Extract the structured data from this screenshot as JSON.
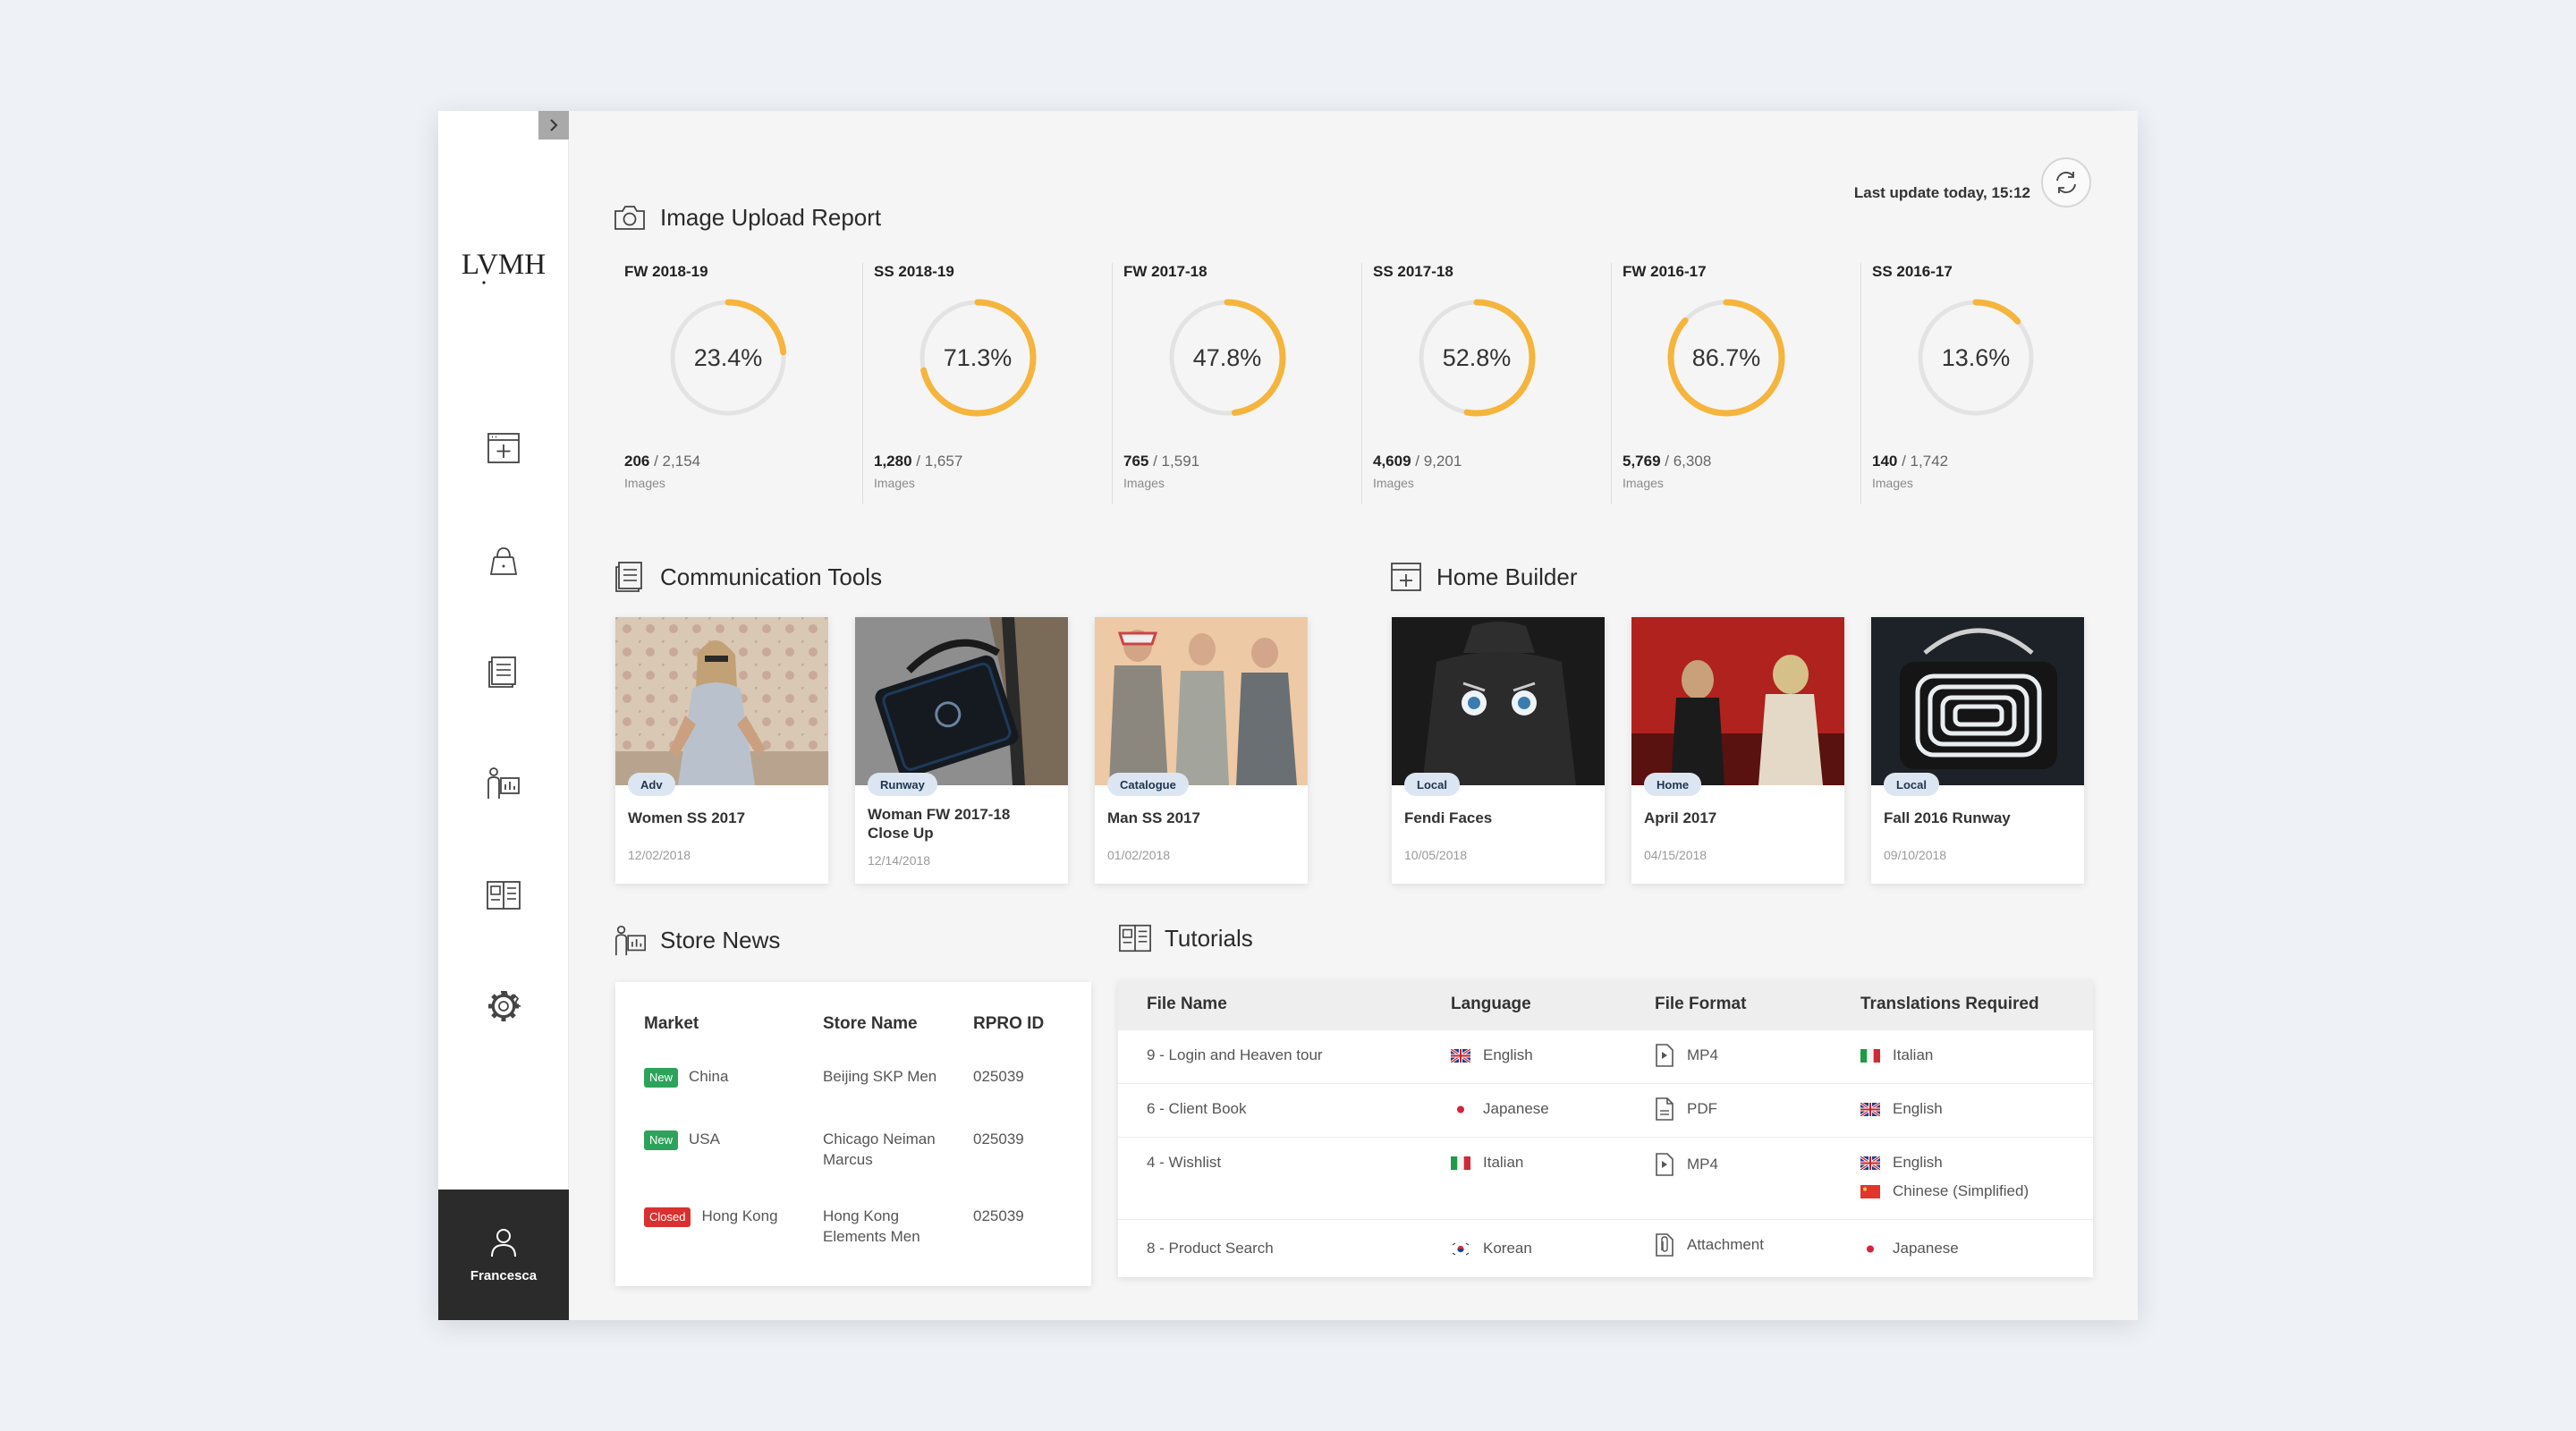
{
  "user": {
    "name": "Francesca"
  },
  "brand": {
    "logo_text": "LVMH"
  },
  "header": {
    "last_update": "Last update today, 15:12"
  },
  "colors": {
    "accent": "#f5b43c",
    "ring_track": "#e3e3e3",
    "badge_new": "#2da25b",
    "badge_closed": "#d93030",
    "sidebar_user_bg": "#2b2b2b"
  },
  "image_upload": {
    "title": "Image Upload Report",
    "stats": [
      {
        "season": "FW 2018-19",
        "percent": 23.4,
        "percent_label": "23.4%",
        "uploaded": "206",
        "total": "/ 2,154",
        "unit": "Images"
      },
      {
        "season": "SS 2018-19",
        "percent": 71.3,
        "percent_label": "71.3%",
        "uploaded": "1,280",
        "total": "/ 1,657",
        "unit": "Images"
      },
      {
        "season": "FW 2017-18",
        "percent": 47.8,
        "percent_label": "47.8%",
        "uploaded": "765",
        "total": "/ 1,591",
        "unit": "Images"
      },
      {
        "season": "SS 2017-18",
        "percent": 52.8,
        "percent_label": "52.8%",
        "uploaded": "4,609",
        "total": "/ 9,201",
        "unit": "Images"
      },
      {
        "season": "FW 2016-17",
        "percent": 86.7,
        "percent_label": "86.7%",
        "uploaded": "5,769",
        "total": "/ 6,308",
        "unit": "Images"
      },
      {
        "season": "SS 2016-17",
        "percent": 13.6,
        "percent_label": "13.6%",
        "uploaded": "140",
        "total": "/ 1,742",
        "unit": "Images"
      }
    ]
  },
  "communication_tools": {
    "title": "Communication Tools",
    "cards": [
      {
        "tag": "Adv",
        "title": "Women SS 2017",
        "date": "12/02/2018"
      },
      {
        "tag": "Runway",
        "title": "Woman FW 2017-18 Close Up",
        "date": "12/14/2018"
      },
      {
        "tag": "Catalogue",
        "title": "Man SS 2017",
        "date": "01/02/2018"
      }
    ]
  },
  "home_builder": {
    "title": "Home Builder",
    "cards": [
      {
        "tag": "Local",
        "title": "Fendi Faces",
        "date": "10/05/2018"
      },
      {
        "tag": "Home",
        "title": "April 2017",
        "date": "04/15/2018"
      },
      {
        "tag": "Local",
        "title": "Fall 2016 Runway",
        "date": "09/10/2018"
      }
    ]
  },
  "store_news": {
    "title": "Store News",
    "columns": [
      "Market",
      "Store Name",
      "RPRO ID"
    ],
    "rows": [
      {
        "status": "New",
        "market": "China",
        "store_name": "Beijing SKP Men",
        "rpro_id": "025039"
      },
      {
        "status": "New",
        "market": "USA",
        "store_name": "Chicago Neiman Marcus",
        "rpro_id": "025039"
      },
      {
        "status": "Closed",
        "market": "Hong Kong",
        "store_name": "Hong Kong Elements Men",
        "rpro_id": "025039"
      }
    ]
  },
  "tutorials": {
    "title": "Tutorials",
    "columns": [
      "File Name",
      "Language",
      "File Format",
      "Translations Required"
    ],
    "rows": [
      {
        "file_name": "9 - Login and Heaven tour",
        "language": "English",
        "language_flag": "uk-flag",
        "format": "MP4",
        "format_icon": "video-file-icon",
        "translations": [
          {
            "lang": "Italian",
            "flag": "italy-flag"
          }
        ]
      },
      {
        "file_name": "6 - Client Book",
        "language": "Japanese",
        "language_flag": "japan-flag",
        "format": "PDF",
        "format_icon": "document-file-icon",
        "translations": [
          {
            "lang": "English",
            "flag": "uk-flag"
          }
        ]
      },
      {
        "file_name": "4 - Wishlist",
        "language": "Italian",
        "language_flag": "italy-flag",
        "format": "MP4",
        "format_icon": "video-file-icon",
        "translations": [
          {
            "lang": "English",
            "flag": "uk-flag"
          },
          {
            "lang": "Chinese (Simplified)",
            "flag": "china-flag"
          }
        ]
      },
      {
        "file_name": "8 - Product Search",
        "language": "Korean",
        "language_flag": "korea-flag",
        "format": "Attachment",
        "format_icon": "attachment-file-icon",
        "translations": [
          {
            "lang": "Japanese",
            "flag": "japan-flag"
          }
        ]
      }
    ]
  }
}
